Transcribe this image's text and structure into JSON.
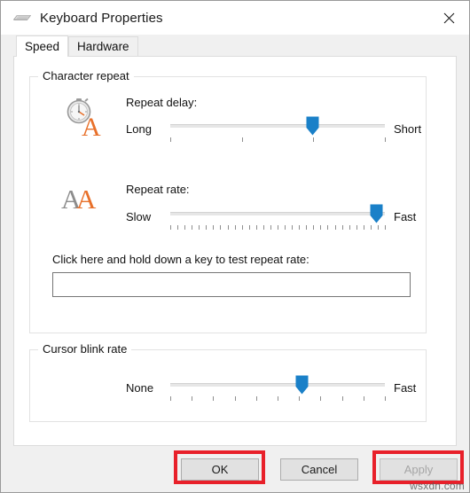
{
  "window": {
    "title": "Keyboard Properties",
    "title_icon": "keyboard-icon",
    "close_icon": "close-icon"
  },
  "tabs": [
    {
      "label": "Speed",
      "active": true
    },
    {
      "label": "Hardware",
      "active": false
    }
  ],
  "groups": {
    "character_repeat": {
      "title": "Character repeat",
      "repeat_delay": {
        "icon": "stopwatch-letter-a-icon",
        "label": "Repeat delay:",
        "min_label": "Long",
        "max_label": "Short",
        "value_percent": 66,
        "tick_count": 4
      },
      "repeat_rate": {
        "icon": "double-letter-a-icon",
        "label": "Repeat rate:",
        "min_label": "Slow",
        "max_label": "Fast",
        "value_percent": 96,
        "tick_count": 31
      },
      "test_field": {
        "caption": "Click here and hold down a key to test repeat rate:",
        "value": "",
        "placeholder": ""
      }
    },
    "cursor_blink": {
      "title": "Cursor blink rate",
      "slider": {
        "min_label": "None",
        "max_label": "Fast",
        "value_percent": 61,
        "tick_count": 11
      }
    }
  },
  "buttons": {
    "ok": "OK",
    "cancel": "Cancel",
    "apply": "Apply",
    "apply_disabled": true
  },
  "annotations": {
    "accent_color": "#e8202a",
    "highlighted": [
      "ok",
      "apply"
    ]
  },
  "watermark": "wsxdn.com",
  "colors": {
    "slider_thumb": "#1a80c8",
    "icon_orange": "#e8702a",
    "icon_gray": "#8c8c8c",
    "window_bg": "#f0f0f0",
    "page_bg": "#ffffff"
  }
}
